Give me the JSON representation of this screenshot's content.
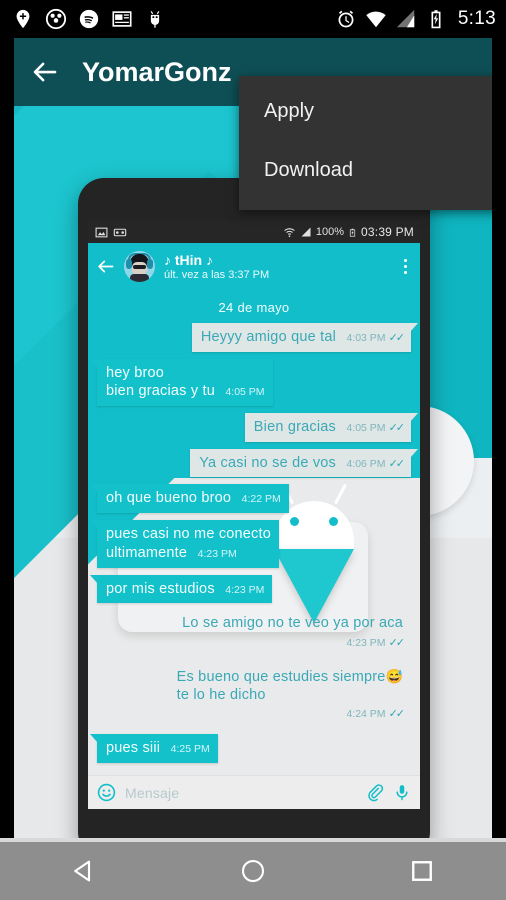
{
  "system_status_bar": {
    "left_icons": [
      "location-pin-plus-icon",
      "soccer-ball-icon",
      "spotify-icon",
      "news-layout-icon",
      "bug-droid-icon"
    ],
    "right_icons": [
      "alarm-clock-icon",
      "wifi-icon",
      "cell-signal-icon",
      "battery-charging-icon"
    ],
    "clock": "5:13"
  },
  "app": {
    "back_label": "back-arrow",
    "title": "YomarGonz"
  },
  "popup_menu": {
    "items": [
      {
        "label": "Apply"
      },
      {
        "label": "Download"
      }
    ]
  },
  "preview": {
    "phone_status_bar": {
      "left_icons": [
        "image-icon",
        "voicemail-icon"
      ],
      "wifi": "wifi-icon",
      "signal": "cell-signal-icon",
      "battery_percent": "100%",
      "battery": "battery-charging-icon",
      "time": "03:39 PM"
    },
    "chat_header": {
      "title": "♪ tHin ♪",
      "subtitle": "últ. vez a las 3:37 PM"
    },
    "day_separator": "24 de mayo",
    "messages": [
      {
        "side": "out",
        "text": "Heyyy amigo que tal",
        "time": "4:03 PM",
        "ticks": "✓✓",
        "style": "bubble"
      },
      {
        "side": "in",
        "text": "hey broo\nbien gracias y tu",
        "time": "4:05 PM",
        "ticks": "",
        "style": "bubble"
      },
      {
        "side": "out",
        "text": "Bien gracias",
        "time": "4:05 PM",
        "ticks": "✓✓",
        "style": "bubble"
      },
      {
        "side": "out",
        "text": "Ya casi no se de vos",
        "time": "4:06 PM",
        "ticks": "✓✓",
        "style": "bubble"
      },
      {
        "side": "in",
        "text": "oh que bueno broo",
        "time": "4:22 PM",
        "ticks": "",
        "style": "bubble"
      },
      {
        "side": "in",
        "text": "pues casi no me conecto\nultimamente",
        "time": "4:23 PM",
        "ticks": "",
        "style": "bubble"
      },
      {
        "side": "in",
        "text": "por mis estudios",
        "time": "4:23 PM",
        "ticks": "",
        "style": "bubble"
      },
      {
        "side": "out",
        "text": "Lo se amigo no te veo ya por aca",
        "time": "4:23 PM",
        "ticks": "✓✓",
        "style": "plain"
      },
      {
        "side": "out",
        "text": "Es bueno que estudies siempre\nte lo he dicho",
        "emoji": "😅",
        "time": "4:24 PM",
        "ticks": "✓✓",
        "style": "plain"
      },
      {
        "side": "in",
        "text": "pues siii",
        "time": "4:25 PM",
        "ticks": "",
        "style": "bubble"
      }
    ],
    "input_bar": {
      "emoji_icon": "emoji-smiley-icon",
      "placeholder": "Mensaje",
      "attach_icon": "paperclip-icon",
      "mic_icon": "microphone-icon"
    }
  },
  "nav_bar": {
    "back": "nav-back-triangle-icon",
    "home": "nav-home-circle-icon",
    "recents": "nav-recents-square-icon"
  },
  "colors": {
    "appbar": "#0e4f55",
    "accent_cyan": "#12bec9",
    "popup_bg": "#333333",
    "nav_bg": "#8e8e8e",
    "bubble_out": "#dfe6e6",
    "bubble_in": "#13c1cb"
  }
}
